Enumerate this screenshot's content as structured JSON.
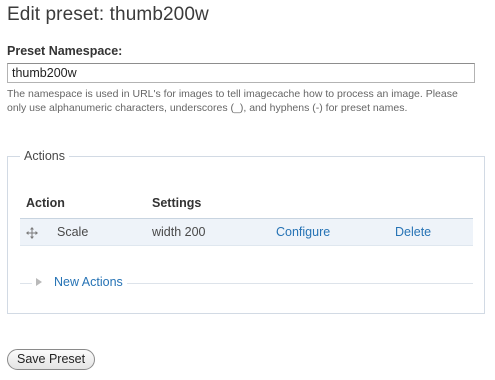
{
  "page": {
    "title": "Edit preset: thumb200w"
  },
  "namespace": {
    "label": "Preset Namespace:",
    "value": "thumb200w",
    "description": "The namespace is used in URL's for images to tell imagecache how to process an image. Please only use alphanumeric characters, underscores (_), and hyphens (-) for preset names."
  },
  "actions": {
    "legend": "Actions",
    "columns": [
      "Action",
      "Settings"
    ],
    "rows": [
      {
        "action": "Scale",
        "settings": "width 200",
        "configure": "Configure",
        "delete": "Delete"
      }
    ],
    "new_actions_label": "New Actions"
  },
  "footer": {
    "save_label": "Save Preset"
  },
  "colors": {
    "link": "#2673b5",
    "row_highlight": "#eef3f9",
    "fieldset_border": "#d2dae4"
  },
  "icons": {
    "drag_handle": "move-cross-icon",
    "collapse": "triangle-right-icon"
  }
}
